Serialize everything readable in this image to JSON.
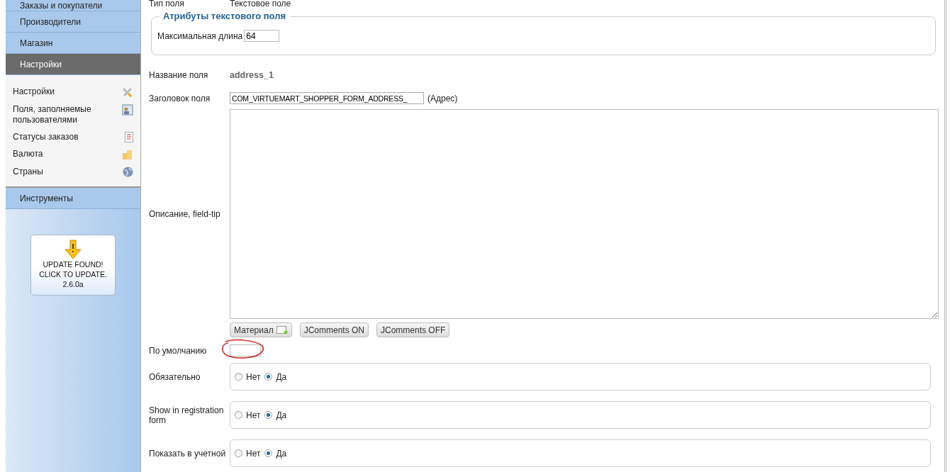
{
  "sidebar": {
    "menu_top": [
      {
        "label": "Заказы и покупатели",
        "selected": false
      },
      {
        "label": "Производители",
        "selected": false
      },
      {
        "label": "Магазин",
        "selected": false
      },
      {
        "label": "Настройки",
        "selected": true
      }
    ],
    "submenu": [
      {
        "label": "Настройки"
      },
      {
        "label": "Поля, заполняемые пользователями"
      },
      {
        "label": "Статусы заказов"
      },
      {
        "label": "Валюта"
      },
      {
        "label": "Страны"
      }
    ],
    "menu_bottom": [
      {
        "label": "Инструменты",
        "selected": false
      }
    ],
    "update_button": {
      "lines": [
        "UPDATE FOUND!",
        "CLICK TO UPDATE.",
        "2.6.0a"
      ]
    }
  },
  "form": {
    "type_row": {
      "label": "Тип поля",
      "value": "Текстовое поле"
    },
    "fieldset": {
      "legend": "Атрибуты текстового поля",
      "label": "Максимальная длина",
      "value": "64"
    },
    "name_row": {
      "label": "Название поля",
      "value": "address_1"
    },
    "title_row": {
      "label": "Заголовок поля",
      "value": "COM_VIRTUEMART_SHOPPER_FORM_ADDRESS_",
      "note": "(Адрес)"
    },
    "description_row": {
      "label": "Описание, field-tip",
      "buttons": [
        "Материал",
        "JComments ON",
        "JComments OFF"
      ]
    },
    "default_row": {
      "label": "По умолчанию",
      "highlighted": true
    },
    "radio_rows": [
      {
        "label": "Обязательно",
        "options": [
          {
            "label": "Нет",
            "selected": false
          },
          {
            "label": "Да",
            "selected": true
          }
        ]
      },
      {
        "label": "Show in registration form",
        "options": [
          {
            "label": "Нет",
            "selected": false
          },
          {
            "label": "Да",
            "selected": true
          }
        ]
      },
      {
        "label": "Показать в учетной",
        "options": [
          {
            "label": "Нет",
            "selected": false
          },
          {
            "label": "Да",
            "selected": true
          }
        ]
      }
    ]
  }
}
